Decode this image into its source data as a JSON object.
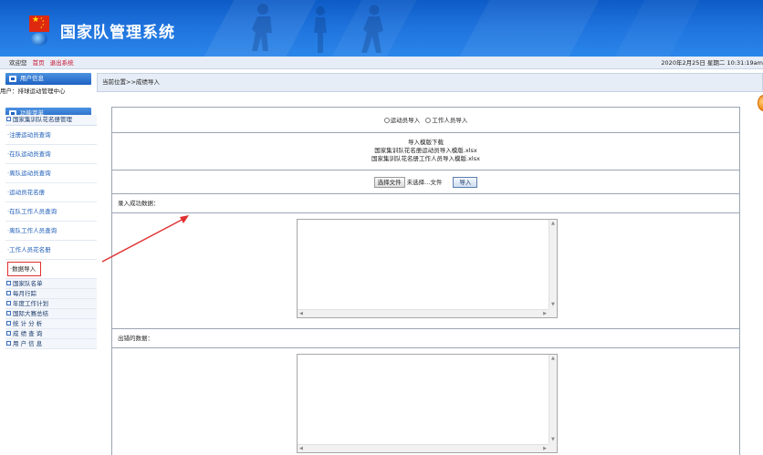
{
  "header": {
    "title": "国家队管理系统"
  },
  "topbar": {
    "welcome": "欢迎您",
    "home_link": "首页",
    "logout_link": "退出系统",
    "datetime": "2020年2月25日 星期二 10:31:19am"
  },
  "sidebar": {
    "user_panel": {
      "title": "用户信息",
      "user_text": "用户：排球运动管理中心"
    },
    "menu_panel": {
      "title": "功能菜单"
    },
    "group": {
      "title": "国家集训队花名册管理",
      "items": [
        {
          "label": "·注册运动员查询"
        },
        {
          "label": "·在队运动员查询"
        },
        {
          "label": "·离队运动员查询"
        },
        {
          "label": "·运动员花名册"
        },
        {
          "label": "·在队工作人员查询"
        },
        {
          "label": "·离队工作人员查询"
        },
        {
          "label": "·工作人员花名册"
        },
        {
          "label": "·数据导入"
        }
      ]
    },
    "nav": [
      {
        "label": "国家队名单"
      },
      {
        "label": "每月行踪"
      },
      {
        "label": "年度工作计划"
      },
      {
        "label": "国际大赛总结"
      },
      {
        "label": "统 计 分 析"
      },
      {
        "label": "成 绩 查 询"
      },
      {
        "label": "用 户 信 息"
      }
    ]
  },
  "main": {
    "breadcrumb": "当前位置>>成绩导入",
    "radio": {
      "athlete": "运动员导入",
      "staff": "工作人员导入"
    },
    "templates": {
      "title": "导入模版下载",
      "athlete_file": "国家集训队花名册运动员导入模版.xlsx",
      "staff_file": "国家集训队花名册工作人员导入模版.xlsx"
    },
    "upload": {
      "choose_button": "选择文件",
      "no_file": "未选择...文件",
      "import_button": "导入"
    },
    "success_label": "录入成功数据：",
    "error_label": "出错的数据："
  }
}
